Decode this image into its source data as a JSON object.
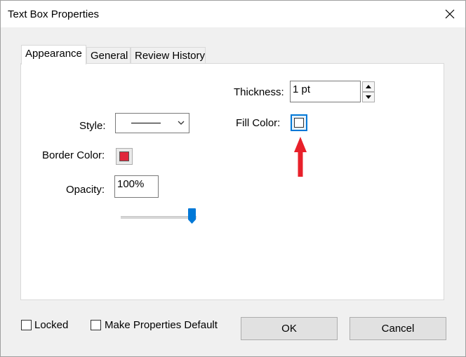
{
  "window": {
    "title": "Text Box Properties"
  },
  "tabs": [
    {
      "label": "Appearance",
      "active": true
    },
    {
      "label": "General",
      "active": false
    },
    {
      "label": "Review History",
      "active": false
    }
  ],
  "appearance": {
    "thickness_label": "Thickness:",
    "thickness_value": "1 pt",
    "fill_color_label": "Fill Color:",
    "style_label": "Style:",
    "border_color_label": "Border Color:",
    "border_color": "#e0263b",
    "opacity_label": "Opacity:",
    "opacity_value": "100%",
    "opacity_slider_level": 1.0
  },
  "footer": {
    "locked_label": "Locked",
    "make_default_label": "Make Properties Default",
    "ok_label": "OK",
    "cancel_label": "Cancel"
  },
  "colors": {
    "accent": "#0078d7",
    "annotation_arrow": "#e8202a"
  }
}
